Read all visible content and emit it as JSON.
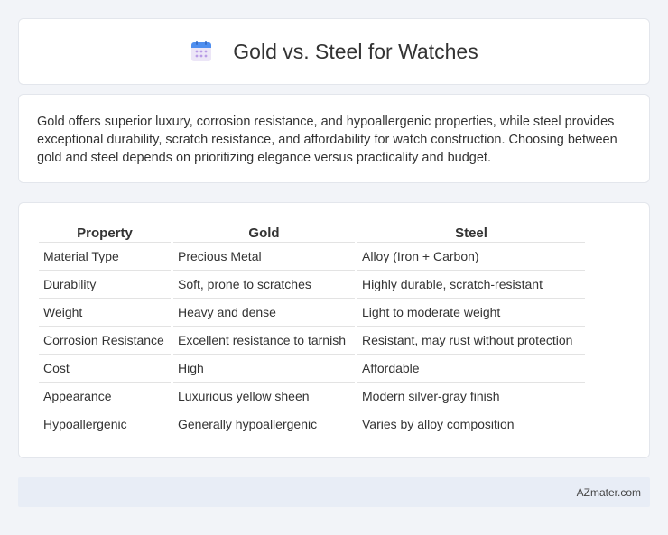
{
  "header": {
    "title": "Gold vs. Steel for Watches",
    "icon": "calendar-icon"
  },
  "summary": {
    "text": "Gold offers superior luxury, corrosion resistance, and hypoallergenic properties, while steel provides exceptional durability, scratch resistance, and affordability for watch construction. Choosing between gold and steel depends on prioritizing elegance versus practicality and budget."
  },
  "table": {
    "headers": [
      "Property",
      "Gold",
      "Steel"
    ],
    "rows": [
      [
        "Material Type",
        "Precious Metal",
        "Alloy (Iron + Carbon)"
      ],
      [
        "Durability",
        "Soft, prone to scratches",
        "Highly durable, scratch-resistant"
      ],
      [
        "Weight",
        "Heavy and dense",
        "Light to moderate weight"
      ],
      [
        "Corrosion Resistance",
        "Excellent resistance to tarnish",
        "Resistant, may rust without protection"
      ],
      [
        "Cost",
        "High",
        "Affordable"
      ],
      [
        "Appearance",
        "Luxurious yellow sheen",
        "Modern silver-gray finish"
      ],
      [
        "Hypoallergenic",
        "Generally hypoallergenic",
        "Varies by alloy composition"
      ]
    ]
  },
  "footer": {
    "brand": "AZmater.com"
  },
  "colors": {
    "background": "#f2f4f8",
    "card": "#ffffff",
    "footer": "#e8edf6",
    "icon_top": "#4f8ff0",
    "icon_body": "#ece6f7",
    "icon_dots": "#b99ce6"
  }
}
